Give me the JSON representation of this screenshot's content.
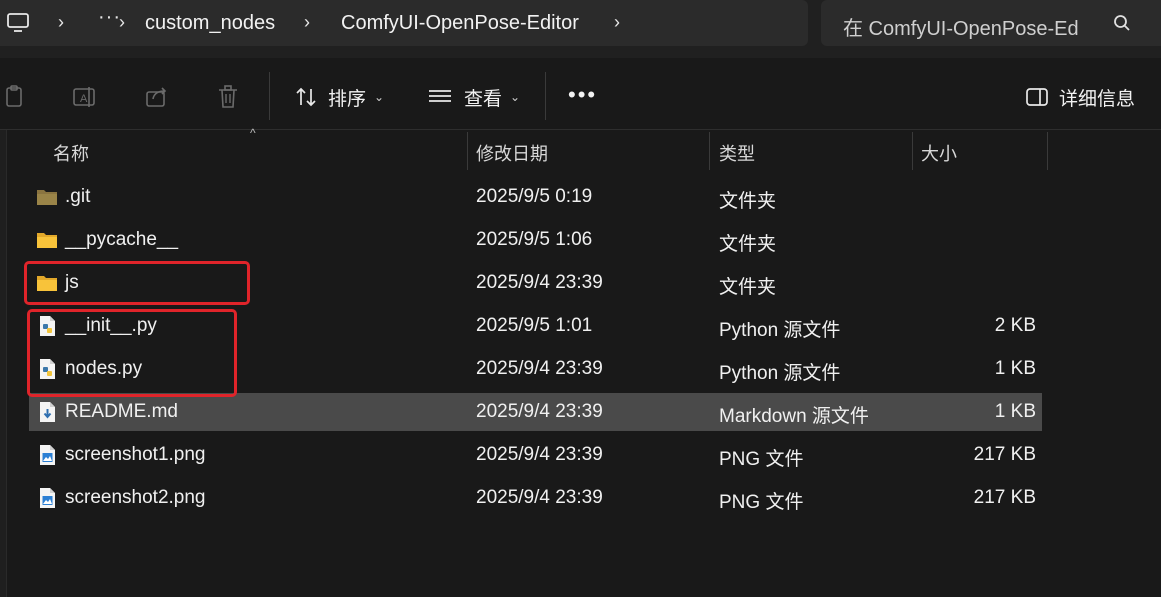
{
  "address_bar": {
    "crumbs": [
      "custom_nodes",
      "ComfyUI-OpenPose-Editor"
    ],
    "overflow": "···"
  },
  "search": {
    "placeholder": "在 ComfyUI-OpenPose-Ed"
  },
  "toolbar": {
    "sort_label": "排序",
    "view_label": "查看",
    "more": "•••",
    "details_label": "详细信息"
  },
  "columns": {
    "name": "名称",
    "date": "修改日期",
    "type": "类型",
    "size": "大小"
  },
  "files": [
    {
      "name": ".git",
      "date": "2025/9/5 0:19",
      "type": "文件夹",
      "size": "",
      "icon": "folder-dark-icon"
    },
    {
      "name": "__pycache__",
      "date": "2025/9/5 1:06",
      "type": "文件夹",
      "size": "",
      "icon": "folder-icon"
    },
    {
      "name": "js",
      "date": "2025/9/4 23:39",
      "type": "文件夹",
      "size": "",
      "icon": "folder-icon"
    },
    {
      "name": "__init__.py",
      "date": "2025/9/5 1:01",
      "type": "Python 源文件",
      "size": "2 KB",
      "icon": "python-file-icon"
    },
    {
      "name": "nodes.py",
      "date": "2025/9/4 23:39",
      "type": "Python 源文件",
      "size": "1 KB",
      "icon": "python-file-icon"
    },
    {
      "name": "README.md",
      "date": "2025/9/4 23:39",
      "type": "Markdown 源文件",
      "size": "1 KB",
      "icon": "markdown-file-icon",
      "selected": true
    },
    {
      "name": "screenshot1.png",
      "date": "2025/9/4 23:39",
      "type": "PNG 文件",
      "size": "217 KB",
      "icon": "image-file-icon"
    },
    {
      "name": "screenshot2.png",
      "date": "2025/9/4 23:39",
      "type": "PNG 文件",
      "size": "217 KB",
      "icon": "image-file-icon"
    }
  ],
  "colors": {
    "background": "#191919",
    "selected_row": "#4a4a4a",
    "highlight": "#e0242a",
    "folder": "#f8c33a"
  }
}
